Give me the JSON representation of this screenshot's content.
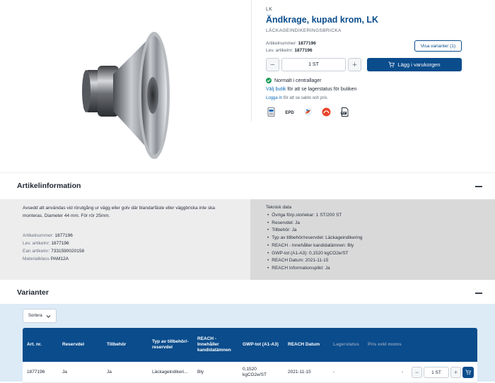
{
  "product": {
    "brand": "LK",
    "title": "Ändkrage, kupad krom, LK",
    "subtitle": "LÄCKAGEINDIKERINGSBRICKA",
    "article_label": "Artikelnummer:",
    "article_value": "1877196",
    "supplier_label": "Lev. artikelnr:",
    "supplier_value": "1877196",
    "variants_button": "Visa varianter (1)",
    "qty_minus": "−",
    "qty_value": "1 ST",
    "qty_plus": "+",
    "cart_button": "Lägg i varukorgen",
    "stock_status": "Normalt i centrallager",
    "store_link": "Välj butik",
    "store_text": " för att se lagerstatus för butiken",
    "login_link": "Logga in",
    "login_text": " för att se saldo och pris",
    "doc_icons": [
      "datasheet-icon",
      "epd-icon",
      "environment-icon",
      "safety-icon",
      "pdf-icon"
    ],
    "epd_text": "EPD",
    "pdf_text": "PDF"
  },
  "article_info": {
    "title": "Artikelinformation",
    "description": "Avsedd att användas vid rörutgång ur vägg eller golv där blandarfäste eller väggbricka inte ska monteras. Diameter 44 mm. För rör 25mm.",
    "fields": [
      {
        "label": "Artikelnummer:",
        "value": "1877196"
      },
      {
        "label": "Lev. artikelnr:",
        "value": "1877196"
      },
      {
        "label": "Ean artikelnr:",
        "value": "7331590020158"
      },
      {
        "label": "Materialklass",
        "value": "PAM12A"
      }
    ],
    "tech_title": "Teknisk data",
    "tech_items": [
      "Övriga förp.storlekar: 1 ST/200 ST",
      "Reservdel: Ja",
      "Tillbehör: Ja",
      "Typ av tillbehör/reservdel: Läckageindikering",
      "REACH - Innehåller kandidatämnen: Bly",
      "GWP-tot (A1-A3): 0,1520 kgCO2e/ST",
      "REACH Datum: 2021-11-15",
      "REACH Informationsplikt: Ja"
    ]
  },
  "variants": {
    "title": "Varianter",
    "sort_label": "Sortera",
    "columns": [
      "Art. nr.",
      "Reservdel",
      "Tillbehör",
      "Typ av tillbehör/-reservdel",
      "REACH - Innehåller kandidatämnen",
      "GWP-tot (A1-A3)",
      "REACH Datum",
      "Lagerstatus",
      "Pris exkl moms"
    ],
    "rows": [
      {
        "art": "1877196",
        "reserv": "Ja",
        "tillbehor": "Ja",
        "typ": "Läckageindikeri...",
        "reach": "Bly",
        "gwp": "0,1520 kgCO2e/ST",
        "datum": "2021-11-15",
        "lager": "-",
        "pris": "-",
        "qty": "1 ST",
        "minus": "−",
        "plus": "+"
      }
    ]
  },
  "colors": {
    "brand_blue": "#0a4c8c",
    "stock_green": "#1e9e5a",
    "variants_bg": "#dcebf6"
  }
}
